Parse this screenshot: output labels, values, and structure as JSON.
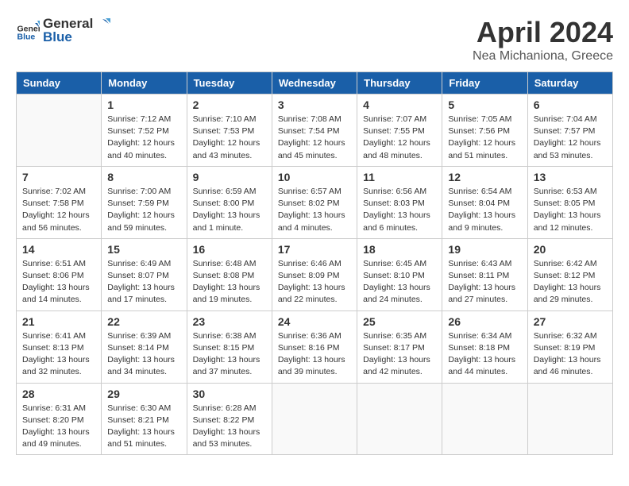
{
  "header": {
    "logo": {
      "general": "General",
      "blue": "Blue"
    },
    "month": "April 2024",
    "location": "Nea Michaniona, Greece"
  },
  "days_of_week": [
    "Sunday",
    "Monday",
    "Tuesday",
    "Wednesday",
    "Thursday",
    "Friday",
    "Saturday"
  ],
  "weeks": [
    [
      {
        "day": null
      },
      {
        "day": "1",
        "sunrise": "7:12 AM",
        "sunset": "7:52 PM",
        "daylight": "12 hours and 40 minutes."
      },
      {
        "day": "2",
        "sunrise": "7:10 AM",
        "sunset": "7:53 PM",
        "daylight": "12 hours and 43 minutes."
      },
      {
        "day": "3",
        "sunrise": "7:08 AM",
        "sunset": "7:54 PM",
        "daylight": "12 hours and 45 minutes."
      },
      {
        "day": "4",
        "sunrise": "7:07 AM",
        "sunset": "7:55 PM",
        "daylight": "12 hours and 48 minutes."
      },
      {
        "day": "5",
        "sunrise": "7:05 AM",
        "sunset": "7:56 PM",
        "daylight": "12 hours and 51 minutes."
      },
      {
        "day": "6",
        "sunrise": "7:04 AM",
        "sunset": "7:57 PM",
        "daylight": "12 hours and 53 minutes."
      }
    ],
    [
      {
        "day": "7",
        "sunrise": "7:02 AM",
        "sunset": "7:58 PM",
        "daylight": "12 hours and 56 minutes."
      },
      {
        "day": "8",
        "sunrise": "7:00 AM",
        "sunset": "7:59 PM",
        "daylight": "12 hours and 59 minutes."
      },
      {
        "day": "9",
        "sunrise": "6:59 AM",
        "sunset": "8:00 PM",
        "daylight": "13 hours and 1 minute."
      },
      {
        "day": "10",
        "sunrise": "6:57 AM",
        "sunset": "8:02 PM",
        "daylight": "13 hours and 4 minutes."
      },
      {
        "day": "11",
        "sunrise": "6:56 AM",
        "sunset": "8:03 PM",
        "daylight": "13 hours and 6 minutes."
      },
      {
        "day": "12",
        "sunrise": "6:54 AM",
        "sunset": "8:04 PM",
        "daylight": "13 hours and 9 minutes."
      },
      {
        "day": "13",
        "sunrise": "6:53 AM",
        "sunset": "8:05 PM",
        "daylight": "13 hours and 12 minutes."
      }
    ],
    [
      {
        "day": "14",
        "sunrise": "6:51 AM",
        "sunset": "8:06 PM",
        "daylight": "13 hours and 14 minutes."
      },
      {
        "day": "15",
        "sunrise": "6:49 AM",
        "sunset": "8:07 PM",
        "daylight": "13 hours and 17 minutes."
      },
      {
        "day": "16",
        "sunrise": "6:48 AM",
        "sunset": "8:08 PM",
        "daylight": "13 hours and 19 minutes."
      },
      {
        "day": "17",
        "sunrise": "6:46 AM",
        "sunset": "8:09 PM",
        "daylight": "13 hours and 22 minutes."
      },
      {
        "day": "18",
        "sunrise": "6:45 AM",
        "sunset": "8:10 PM",
        "daylight": "13 hours and 24 minutes."
      },
      {
        "day": "19",
        "sunrise": "6:43 AM",
        "sunset": "8:11 PM",
        "daylight": "13 hours and 27 minutes."
      },
      {
        "day": "20",
        "sunrise": "6:42 AM",
        "sunset": "8:12 PM",
        "daylight": "13 hours and 29 minutes."
      }
    ],
    [
      {
        "day": "21",
        "sunrise": "6:41 AM",
        "sunset": "8:13 PM",
        "daylight": "13 hours and 32 minutes."
      },
      {
        "day": "22",
        "sunrise": "6:39 AM",
        "sunset": "8:14 PM",
        "daylight": "13 hours and 34 minutes."
      },
      {
        "day": "23",
        "sunrise": "6:38 AM",
        "sunset": "8:15 PM",
        "daylight": "13 hours and 37 minutes."
      },
      {
        "day": "24",
        "sunrise": "6:36 AM",
        "sunset": "8:16 PM",
        "daylight": "13 hours and 39 minutes."
      },
      {
        "day": "25",
        "sunrise": "6:35 AM",
        "sunset": "8:17 PM",
        "daylight": "13 hours and 42 minutes."
      },
      {
        "day": "26",
        "sunrise": "6:34 AM",
        "sunset": "8:18 PM",
        "daylight": "13 hours and 44 minutes."
      },
      {
        "day": "27",
        "sunrise": "6:32 AM",
        "sunset": "8:19 PM",
        "daylight": "13 hours and 46 minutes."
      }
    ],
    [
      {
        "day": "28",
        "sunrise": "6:31 AM",
        "sunset": "8:20 PM",
        "daylight": "13 hours and 49 minutes."
      },
      {
        "day": "29",
        "sunrise": "6:30 AM",
        "sunset": "8:21 PM",
        "daylight": "13 hours and 51 minutes."
      },
      {
        "day": "30",
        "sunrise": "6:28 AM",
        "sunset": "8:22 PM",
        "daylight": "13 hours and 53 minutes."
      },
      {
        "day": null
      },
      {
        "day": null
      },
      {
        "day": null
      },
      {
        "day": null
      }
    ]
  ],
  "labels": {
    "sunrise_prefix": "Sunrise: ",
    "sunset_prefix": "Sunset: ",
    "daylight_prefix": "Daylight: "
  }
}
